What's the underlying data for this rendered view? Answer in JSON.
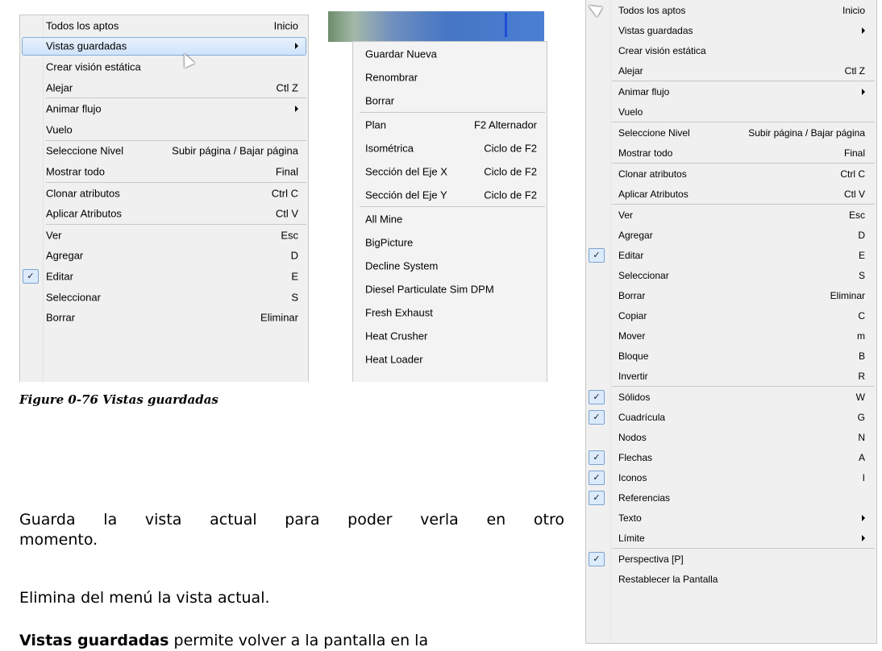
{
  "menu_left": {
    "items": [
      {
        "label": "Todos los aptos",
        "shortcut": "Inicio"
      },
      {
        "label": "Vistas guardadas",
        "shortcut": "",
        "submenu": true,
        "highlighted": true
      },
      {
        "label": "Crear visión estática",
        "shortcut": ""
      },
      {
        "label": "Alejar",
        "shortcut": "Ctl Z"
      },
      {
        "sep": true
      },
      {
        "label": "Animar flujo",
        "shortcut": "",
        "submenu": true
      },
      {
        "label": "Vuelo",
        "shortcut": ""
      },
      {
        "sep": true
      },
      {
        "label": "Seleccione Nivel",
        "shortcut": "Subir página / Bajar página"
      },
      {
        "label": "Mostrar todo",
        "shortcut": "Final"
      },
      {
        "sep": true
      },
      {
        "label": "Clonar atributos",
        "shortcut": "Ctrl C"
      },
      {
        "label": "Aplicar Atributos",
        "shortcut": "Ctl V"
      },
      {
        "sep": true
      },
      {
        "label": "Ver",
        "shortcut": "Esc"
      },
      {
        "label": "Agregar",
        "shortcut": "D"
      },
      {
        "label": "Editar",
        "shortcut": "E",
        "checked": true
      },
      {
        "label": "Seleccionar",
        "shortcut": "S"
      },
      {
        "label": "Borrar",
        "shortcut": "Eliminar"
      }
    ]
  },
  "submenu": {
    "items": [
      {
        "label": "Guardar Nueva",
        "shortcut": ""
      },
      {
        "label": "Renombrar",
        "shortcut": ""
      },
      {
        "label": "Borrar",
        "shortcut": ""
      },
      {
        "sep": true
      },
      {
        "label": "Plan",
        "shortcut": "F2 Alternador"
      },
      {
        "label": "Isométrica",
        "shortcut": "Ciclo de F2"
      },
      {
        "label": "Sección del Eje X",
        "shortcut": "Ciclo de F2"
      },
      {
        "label": "Sección del Eje Y",
        "shortcut": "Ciclo de F2"
      },
      {
        "sep": true
      },
      {
        "label": "All Mine",
        "shortcut": ""
      },
      {
        "label": "BigPicture",
        "shortcut": ""
      },
      {
        "label": "Decline System",
        "shortcut": ""
      },
      {
        "label": "Diesel Particulate Sim DPM",
        "shortcut": ""
      },
      {
        "label": "Fresh Exhaust",
        "shortcut": ""
      },
      {
        "label": "Heat Crusher",
        "shortcut": ""
      },
      {
        "label": "Heat Loader",
        "shortcut": ""
      }
    ]
  },
  "menu_right": {
    "items": [
      {
        "label": "Todos los aptos",
        "shortcut": "Inicio"
      },
      {
        "label": "Vistas guardadas",
        "shortcut": "",
        "submenu": true
      },
      {
        "label": "Crear visión estática",
        "shortcut": ""
      },
      {
        "label": "Alejar",
        "shortcut": "Ctl Z"
      },
      {
        "sep": true
      },
      {
        "label": "Animar flujo",
        "shortcut": "",
        "submenu": true
      },
      {
        "label": "Vuelo",
        "shortcut": ""
      },
      {
        "sep": true
      },
      {
        "label": "Seleccione Nivel",
        "shortcut": "Subir página / Bajar página"
      },
      {
        "label": "Mostrar todo",
        "shortcut": "Final"
      },
      {
        "sep": true
      },
      {
        "label": "Clonar atributos",
        "shortcut": "Ctrl C"
      },
      {
        "label": "Aplicar Atributos",
        "shortcut": "Ctl V"
      },
      {
        "sep": true
      },
      {
        "label": "Ver",
        "shortcut": "Esc"
      },
      {
        "label": "Agregar",
        "shortcut": "D"
      },
      {
        "label": "Editar",
        "shortcut": "E",
        "checked": true
      },
      {
        "label": "Seleccionar",
        "shortcut": "S"
      },
      {
        "label": "Borrar",
        "shortcut": "Eliminar"
      },
      {
        "label": "Copiar",
        "shortcut": "C"
      },
      {
        "label": "Mover",
        "shortcut": "m"
      },
      {
        "label": "Bloque",
        "shortcut": "B"
      },
      {
        "label": "Invertir",
        "shortcut": "R"
      },
      {
        "sep": true
      },
      {
        "label": "Sólidos",
        "shortcut": "W",
        "checked": true
      },
      {
        "label": "Cuadrícula",
        "shortcut": "G",
        "checked": true
      },
      {
        "label": "Nodos",
        "shortcut": "N"
      },
      {
        "label": "Flechas",
        "shortcut": "A",
        "checked": true
      },
      {
        "label": "Iconos",
        "shortcut": "I",
        "checked": true
      },
      {
        "label": "Referencias",
        "shortcut": "",
        "checked": true
      },
      {
        "label": "Texto",
        "shortcut": "",
        "submenu": true
      },
      {
        "label": "Límite",
        "shortcut": "",
        "submenu": true
      },
      {
        "sep": true
      },
      {
        "label": "Perspectiva [P]",
        "shortcut": "",
        "checked": true
      },
      {
        "label": "Restablecer la Pantalla",
        "shortcut": ""
      }
    ]
  },
  "caption": "Figure 0-76  Vistas guardadas",
  "text": {
    "p1_line1": "Guarda la vista actual para poder verla en otro",
    "p1_line2": "momento.",
    "p2": "Elimina del menú la vista actual.",
    "p3_bold": "Vistas guardadas",
    "p3_rest": " permite volver a la pantalla en la"
  },
  "colors": {
    "menu_bg": "#f0f0f0",
    "highlight_border": "#84acdd",
    "check_bg": "#dcebfc"
  }
}
